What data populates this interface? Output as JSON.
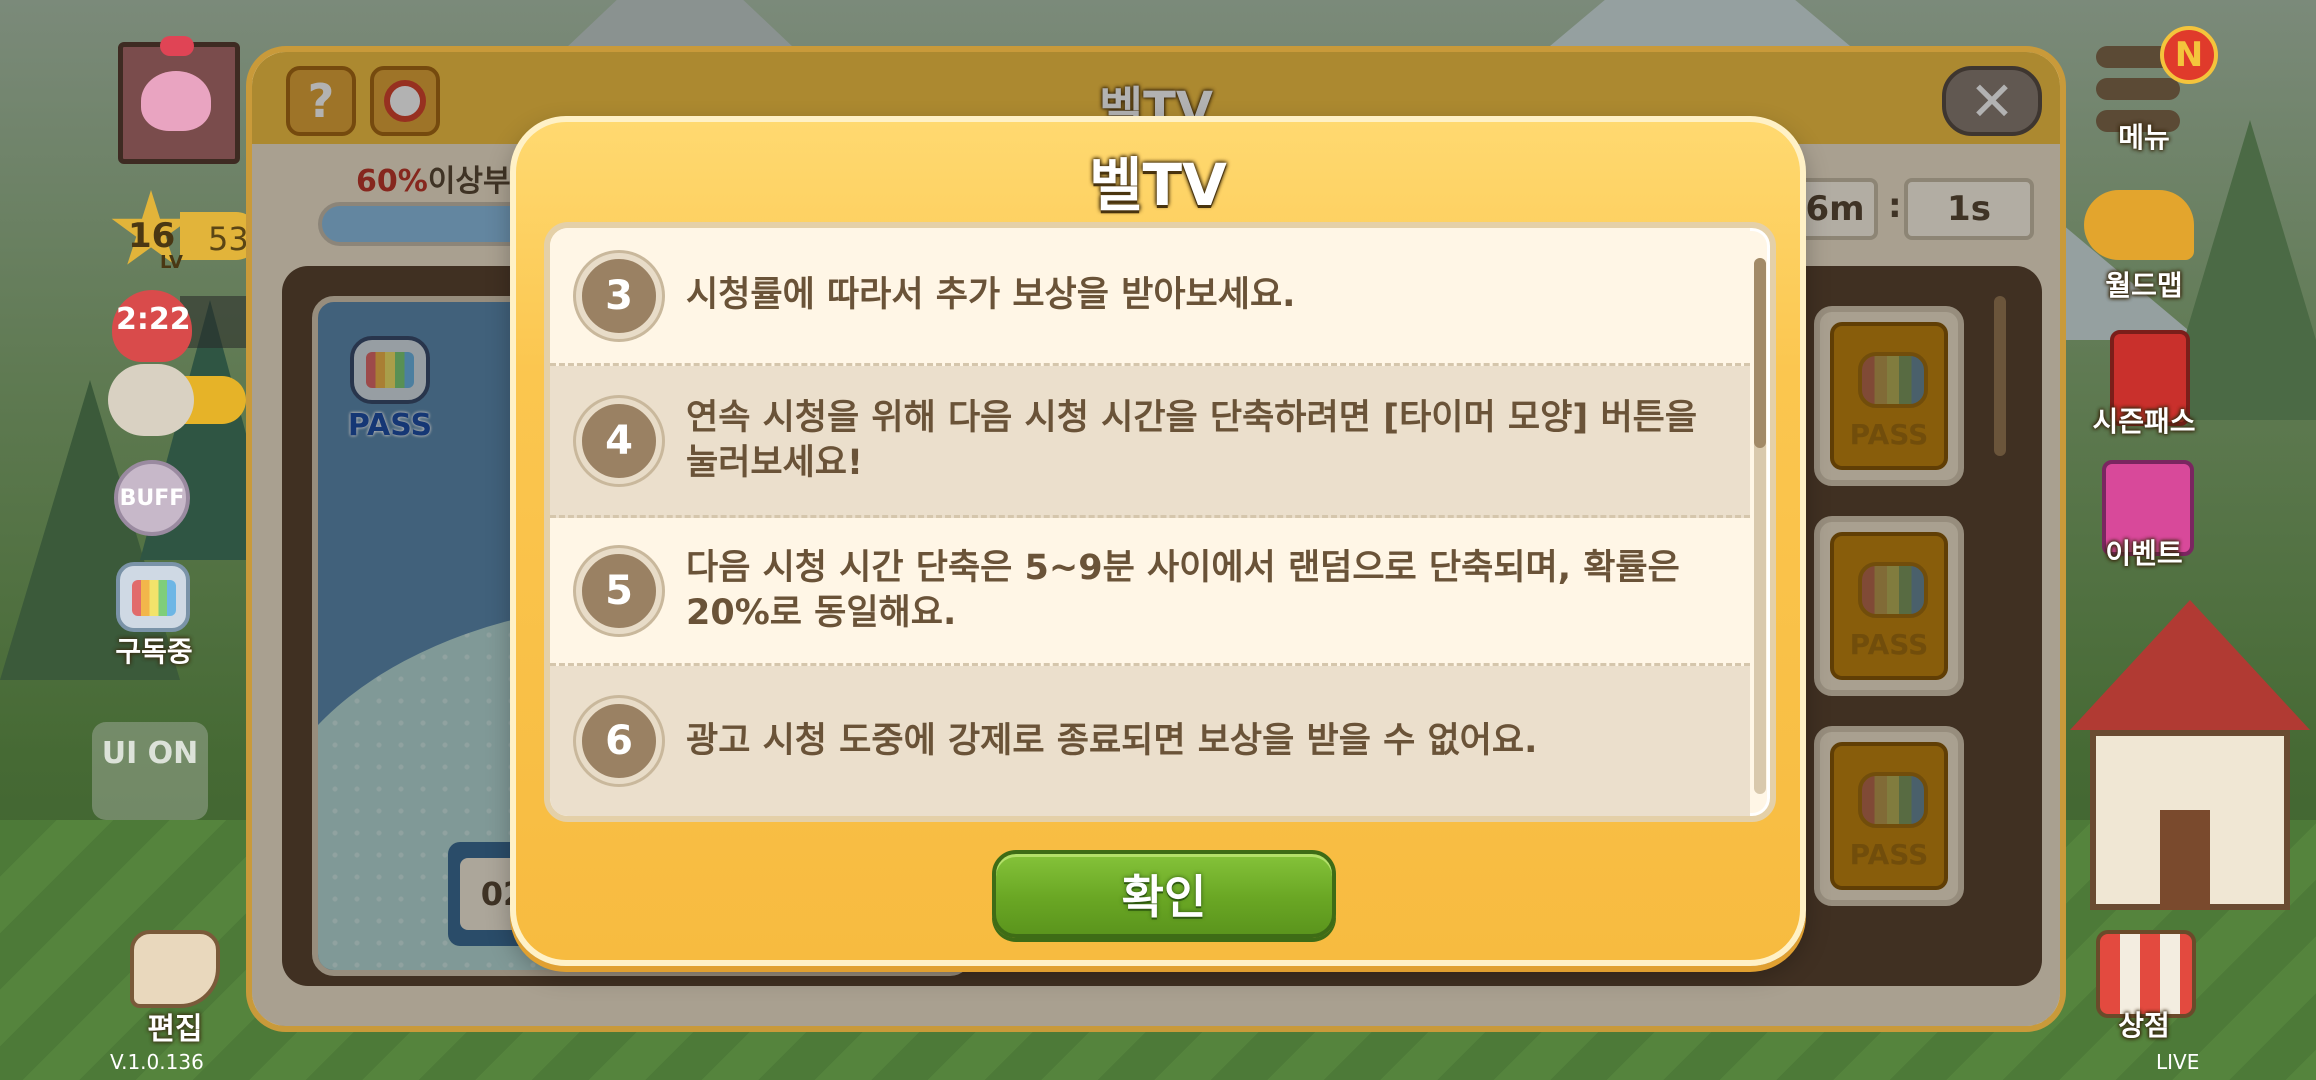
{
  "hud_left": {
    "level": "16",
    "level_label": "LV",
    "level_progress_text": "53",
    "heart_timer": "2:22",
    "buff_label": "BUFF",
    "subscribed_label": "구독중",
    "ui_toggle_label": "UI ON",
    "edit_label": "편집",
    "version": "V.1.0.136"
  },
  "hud_right": {
    "menu_label": "메뉴",
    "menu_badge": "N",
    "world_map_label": "월드맵",
    "season_pass_label": "시즌패스",
    "event_label": "이벤트",
    "shop_label": "상점",
    "live_label": "LIVE"
  },
  "main_window": {
    "title": "벨TV",
    "help_icon_text": "?",
    "close_icon_text": "✕",
    "ratio_percent": "60%",
    "ratio_text": "이상부",
    "timer_minutes": "6m",
    "timer_separator": ":",
    "timer_seconds": "1s",
    "pass_badge": "PASS",
    "episode_number": "02"
  },
  "modal": {
    "title": "벨TV",
    "items": [
      {
        "number": "3",
        "text": "시청률에 따라서 추가 보상을 받아보세요."
      },
      {
        "number": "4",
        "text": "연속 시청을 위해 다음 시청 시간을 단축하려면 [타이머 모양] 버튼을 눌러보세요!"
      },
      {
        "number": "5",
        "text": "다음 시청 시간 단축은 5~9분 사이에서 랜덤으로 단축되며, 확률은 20%로 동일해요."
      },
      {
        "number": "6",
        "text": "광고 시청 도중에 강제로 종료되면 보상을 받을 수 없어요."
      }
    ],
    "confirm_label": "확인"
  },
  "colors": {
    "modal_yellow": "#f7bb40",
    "confirm_green": "#6aa724",
    "text_brown": "#6a5338",
    "badge_brown": "#9a8163",
    "accent_red": "#c0392b"
  }
}
